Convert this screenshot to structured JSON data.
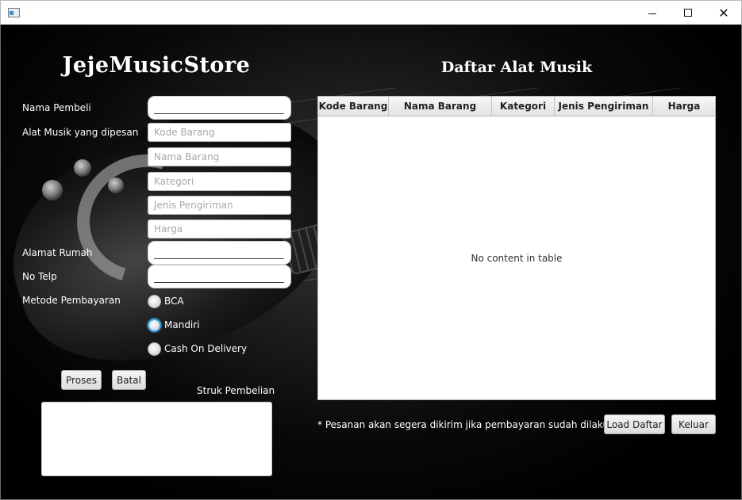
{
  "window": {
    "icon": "java-app-icon",
    "controls": {
      "minimize": "minimize-icon",
      "maximize": "maximize-icon",
      "close": "close-icon"
    }
  },
  "app_title": "JejeMusicStore",
  "form": {
    "nama_pembeli_label": "Nama Pembeli",
    "nama_pembeli_value": "",
    "alat_musik_label": "Alat Musik yang dipesan",
    "kode_barang_placeholder": "Kode Barang",
    "nama_barang_placeholder": "Nama Barang",
    "kategori_placeholder": "Kategori",
    "jenis_pengiriman_placeholder": "Jenis Pengiriman",
    "harga_placeholder": "Harga",
    "alamat_label": "Alamat Rumah",
    "alamat_value": "",
    "telp_label": "No Telp",
    "telp_value": "",
    "metode_label": "Metode Pembayaran",
    "payment_options": [
      "BCA",
      "Mandiri",
      "Cash On Delivery"
    ],
    "selected_payment": ""
  },
  "buttons": {
    "proses": "Proses",
    "batal": "Batal",
    "load_daftar": "Load Daftar",
    "keluar": "Keluar"
  },
  "struk": {
    "label": "Struk Pembelian",
    "content": ""
  },
  "table": {
    "title": "Daftar Alat Musik",
    "columns": [
      "Kode Barang",
      "Nama Barang",
      "Kategori",
      "Jenis Pengiriman",
      "Harga"
    ],
    "rows": [],
    "empty_message": "No content in table"
  },
  "note": "* Pesanan akan segera dikirim jika pembayaran sudah dilakukan"
}
